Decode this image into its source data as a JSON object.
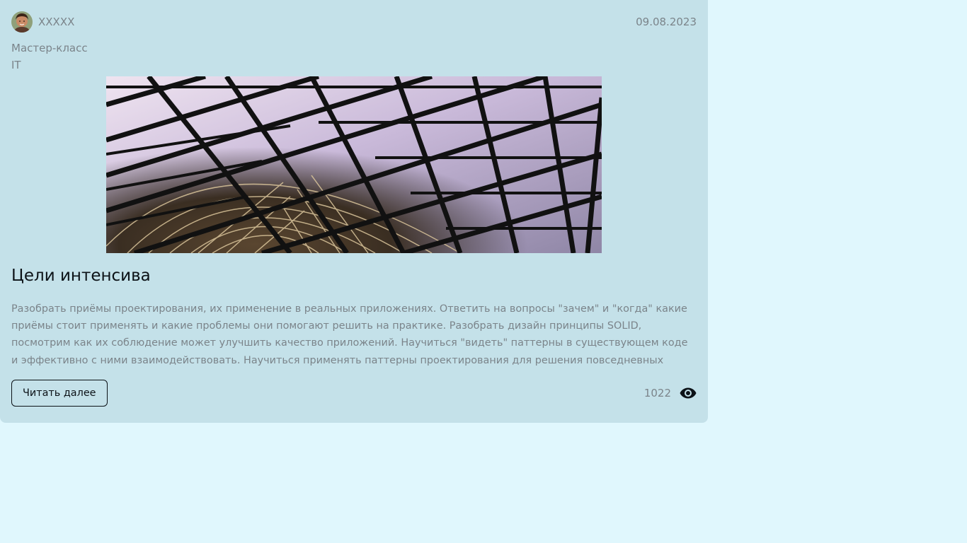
{
  "post": {
    "author": {
      "name": "XXXXX",
      "avatar_icon": "avatar-photo"
    },
    "date": "09.08.2023",
    "tags": [
      "Мастер-класс",
      "IT"
    ],
    "image": {
      "icon": "glass-lattice-roof-photo"
    },
    "title": "Цели интенсива",
    "description": "Разобрать приёмы проектирования, их применение в реальных приложениях. Ответить на вопросы \"зачем\" и \"когда\" какие приёмы стоит применять и какие проблемы они помогают решить на практике. Разобрать дизайн принципы SOLID, посмотрим как их соблюдение может улучшить качество приложений. Научиться \"видеть\" паттерны в существующем коде и эффективно с ними взаимодействовать. Научиться применять паттерны проектирования для решения повседневных задач.",
    "read_more_label": "Читать далее",
    "views": "1022",
    "views_icon": "eye-icon"
  },
  "colors": {
    "page_background": "#e0f7fd",
    "card_background": "#c4e1e9",
    "muted_text": "#7b848a",
    "primary_text": "#0c1217"
  }
}
